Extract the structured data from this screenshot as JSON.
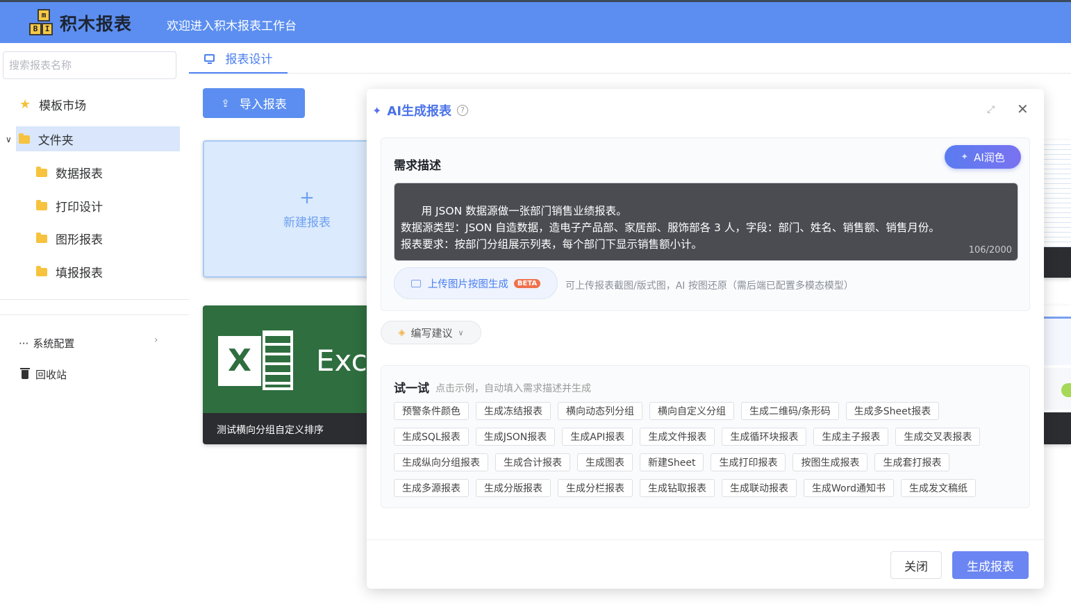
{
  "header": {
    "logo_blocks": [
      "m",
      "B",
      "I"
    ],
    "logo_text": "积木报表",
    "welcome": "欢迎进入积木报表工作台",
    "bg_color": "#5b8ef0"
  },
  "sidebar": {
    "search_placeholder": "搜索报表名称",
    "market_label": "模板市场",
    "folder_label": "文件夹",
    "folder_items": [
      "数据报表",
      "打印设计",
      "图形报表",
      "填报报表"
    ],
    "system_label": "系统配置",
    "recycle_label": "回收站"
  },
  "main": {
    "tab_label": "报表设计",
    "import_label": "导入报表",
    "new_report_label": "新建报表",
    "excel_word": "Exc",
    "card_title": "测试横向分组自定义排序"
  },
  "dialog": {
    "title": "AI生成报表",
    "help": "?",
    "req_label": "需求描述",
    "ai_polish_label": "AI润色",
    "description": "用 JSON 数据源做一张部门销售业绩报表。\n数据源类型：JSON 自造数据，造电子产品部、家居部、服饰部各 3 人，字段：部门、姓名、销售额、销售月份。\n报表要求：按部门分组展示列表，每个部门下显示销售额小计。",
    "counter": "106/2000",
    "upload_label": "上传图片按图生成",
    "beta": "BETA",
    "upload_hint": "可上传报表截图/版式图，AI 按图还原（需后端已配置多模态模型）",
    "tips_label": "编写建议",
    "try_title": "试一试",
    "try_hint": "点击示例，自动填入需求描述并生成",
    "chip_rows": [
      [
        "预警条件颜色",
        "生成冻结报表",
        "横向动态列分组",
        "横向自定义分组",
        "生成二维码/条形码",
        "生成多Sheet报表"
      ],
      [
        "生成SQL报表",
        "生成JSON报表",
        "生成API报表",
        "生成文件报表",
        "生成循环块报表",
        "生成主子报表",
        "生成交叉表报表"
      ],
      [
        "生成纵向分组报表",
        "生成合计报表",
        "生成图表",
        "新建Sheet",
        "生成打印报表",
        "按图生成报表",
        "生成套打报表"
      ],
      [
        "生成多源报表",
        "生成分版报表",
        "生成分栏报表",
        "生成钻取报表",
        "生成联动报表",
        "生成Word通知书",
        "生成发文稿纸"
      ]
    ],
    "close_label": "关闭",
    "generate_label": "生成报表"
  }
}
